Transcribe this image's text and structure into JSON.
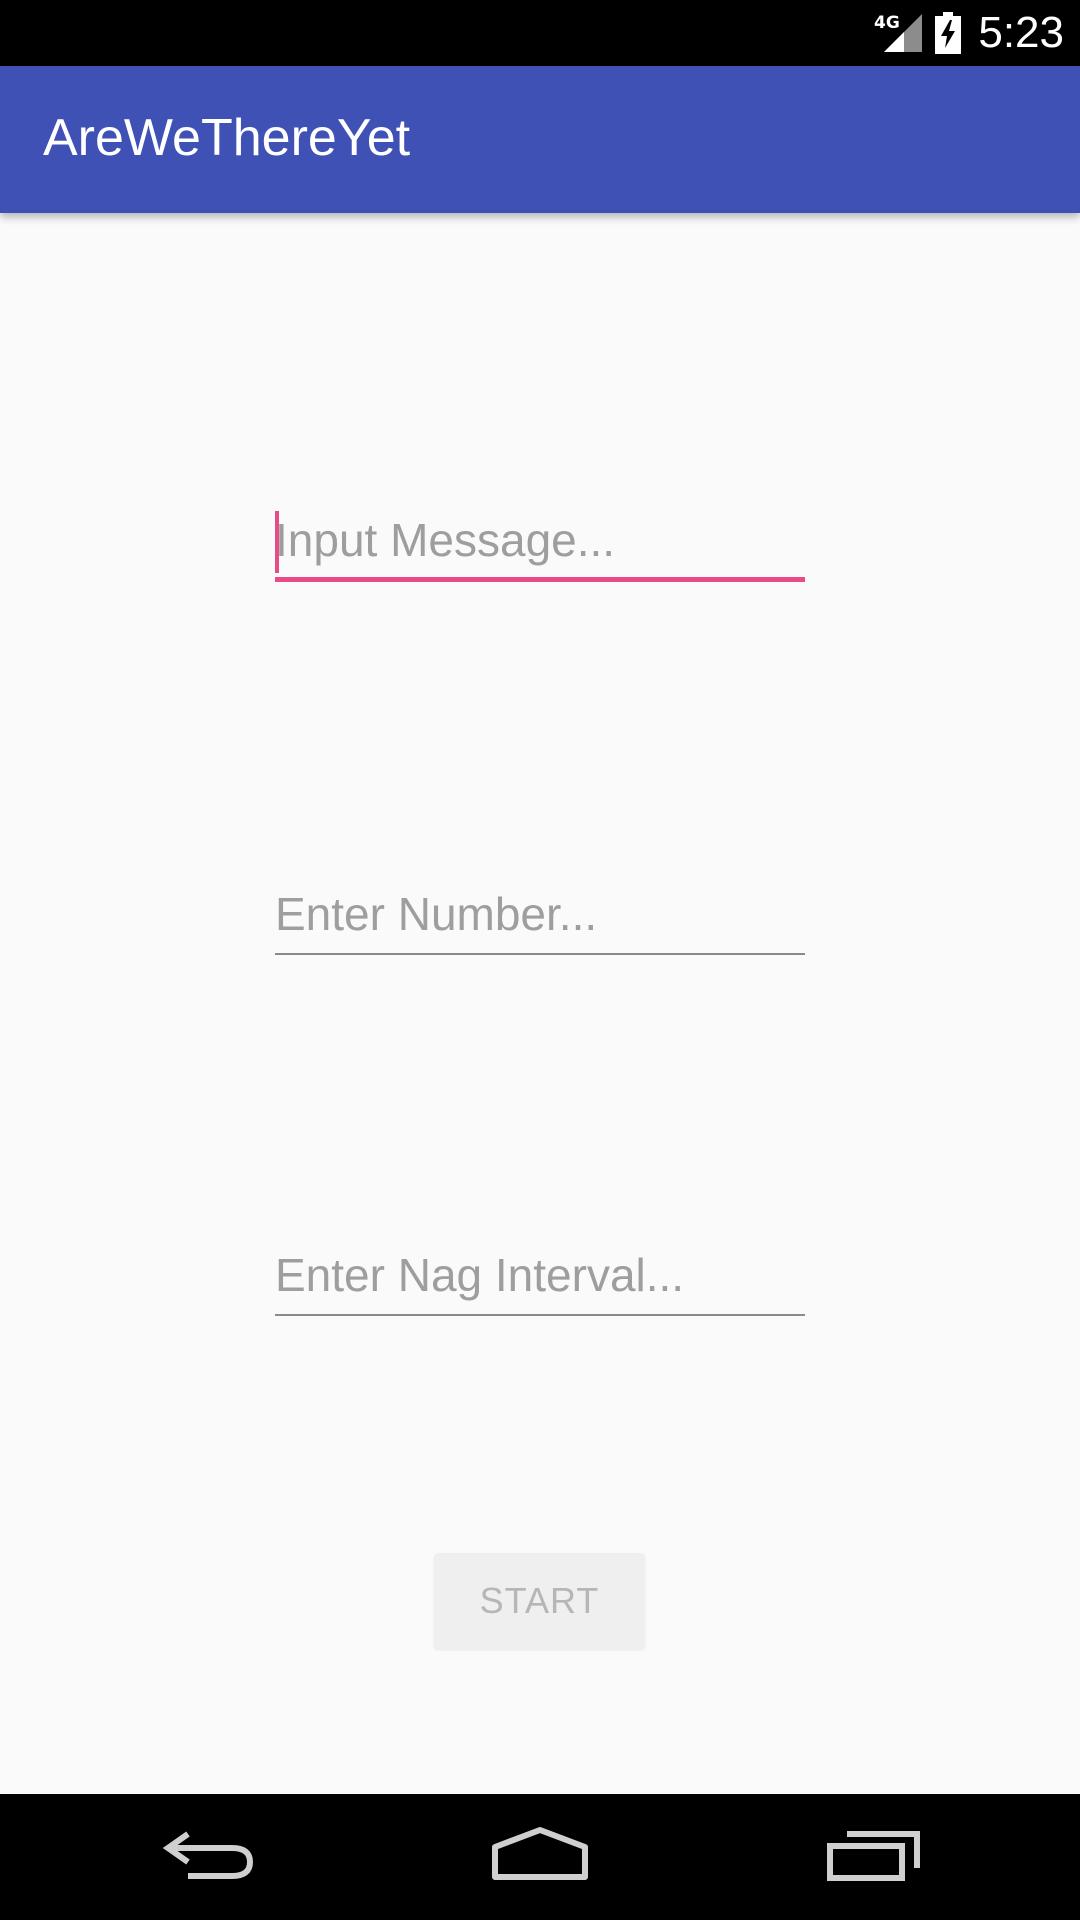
{
  "status_bar": {
    "network_label": "4G",
    "time": "5:23",
    "icons": [
      "signal-icon",
      "battery-charging-icon"
    ]
  },
  "app_bar": {
    "title": "AreWeThereYet",
    "background_color": "#3f51b5"
  },
  "form": {
    "message_field": {
      "placeholder": "Input Message...",
      "value": ""
    },
    "number_field": {
      "placeholder": "Enter Number...",
      "value": ""
    },
    "interval_field": {
      "placeholder": "Enter Nag Interval...",
      "value": ""
    },
    "start_button_label": "START",
    "accent_color": "#e94b87"
  },
  "nav_bar": {
    "icons": [
      "back-icon",
      "home-icon",
      "recents-icon"
    ]
  }
}
